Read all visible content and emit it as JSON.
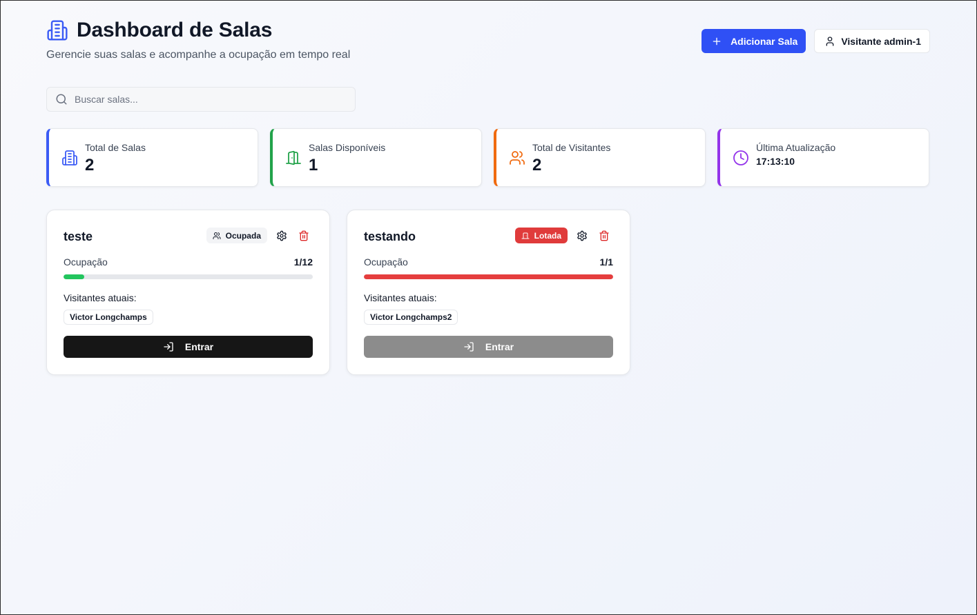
{
  "header": {
    "title": "Dashboard de Salas",
    "subtitle": "Gerencie suas salas e acompanhe a ocupação em tempo real",
    "title_icon": "building-icon",
    "add_room_label": "Adicionar Sala",
    "user_label": "Visitante admin-1"
  },
  "search": {
    "placeholder": "Buscar salas...",
    "value": ""
  },
  "stats": [
    {
      "label": "Total de Salas",
      "value": "2",
      "icon": "building-icon",
      "color": "#3b5bf5"
    },
    {
      "label": "Salas Disponíveis",
      "value": "1",
      "icon": "door-open-icon",
      "color": "#22a34a"
    },
    {
      "label": "Total de Visitantes",
      "value": "2",
      "icon": "users-icon",
      "color": "#f06a0f"
    },
    {
      "label": "Última Atualização",
      "value": "17:13:10",
      "icon": "clock-icon",
      "color": "#9333ea"
    }
  ],
  "rooms": [
    {
      "name": "teste",
      "status": "Ocupada",
      "occupancy_label": "Ocupação",
      "occupancy": "1/12",
      "occupancy_fraction": 0.0833,
      "bar_color": "#22c55e",
      "visitors_label": "Visitantes atuais:",
      "visitors": [
        "Victor Longchamps"
      ],
      "enter_label": "Entrar",
      "enter_enabled": true
    },
    {
      "name": "testando",
      "status": "Lotada",
      "occupancy_label": "Ocupação",
      "occupancy": "1/1",
      "occupancy_fraction": 1.0,
      "bar_color": "#e53e3e",
      "visitors_label": "Visitantes atuais:",
      "visitors": [
        "Victor Longchamps2"
      ],
      "enter_label": "Entrar",
      "enter_enabled": false
    }
  ],
  "colors": {
    "primary": "#2f50f5",
    "danger": "#e03b3b",
    "settings_icon": "#111827",
    "delete_icon": "#dc2626"
  }
}
